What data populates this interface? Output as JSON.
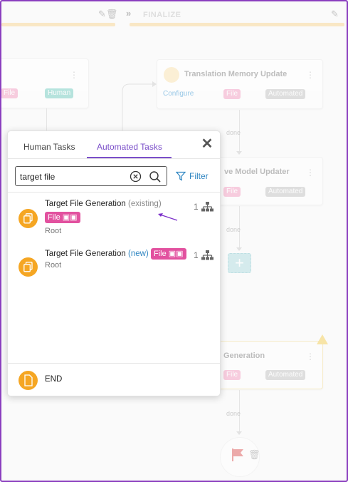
{
  "header": {
    "stage_label": "FINALIZE"
  },
  "nodes": {
    "left_card": {
      "file_tag": "File",
      "role_tag": "Human"
    },
    "translation_memory": {
      "title": "Translation Memory Update",
      "configure": "Configure",
      "file_tag": "File",
      "mode_tag": "Automated"
    },
    "model_updater": {
      "title": "ve Model Updater",
      "file_tag": "File",
      "mode_tag": "Automated"
    },
    "generation": {
      "title": "Generation",
      "file_tag": "File",
      "mode_tag": "Automated"
    },
    "connector_label": "done"
  },
  "panel": {
    "tabs": [
      {
        "label": "Human Tasks",
        "active": false
      },
      {
        "label": "Automated Tasks",
        "active": true
      }
    ],
    "search": {
      "value": "target file"
    },
    "filter_label": "Filter",
    "results": [
      {
        "title": "Target File Generation",
        "status": "(existing)",
        "tag": "File",
        "subtitle": "Root",
        "count": "1"
      },
      {
        "title": "Target File Generation",
        "status": "(new)",
        "tag": "File",
        "subtitle": "Root",
        "count": "1"
      }
    ],
    "end_label": "END"
  },
  "colors": {
    "accent": "#7b4fc9",
    "file_tag": "#e2519f",
    "task_icon": "#f5a623",
    "link": "#2f86c2"
  }
}
